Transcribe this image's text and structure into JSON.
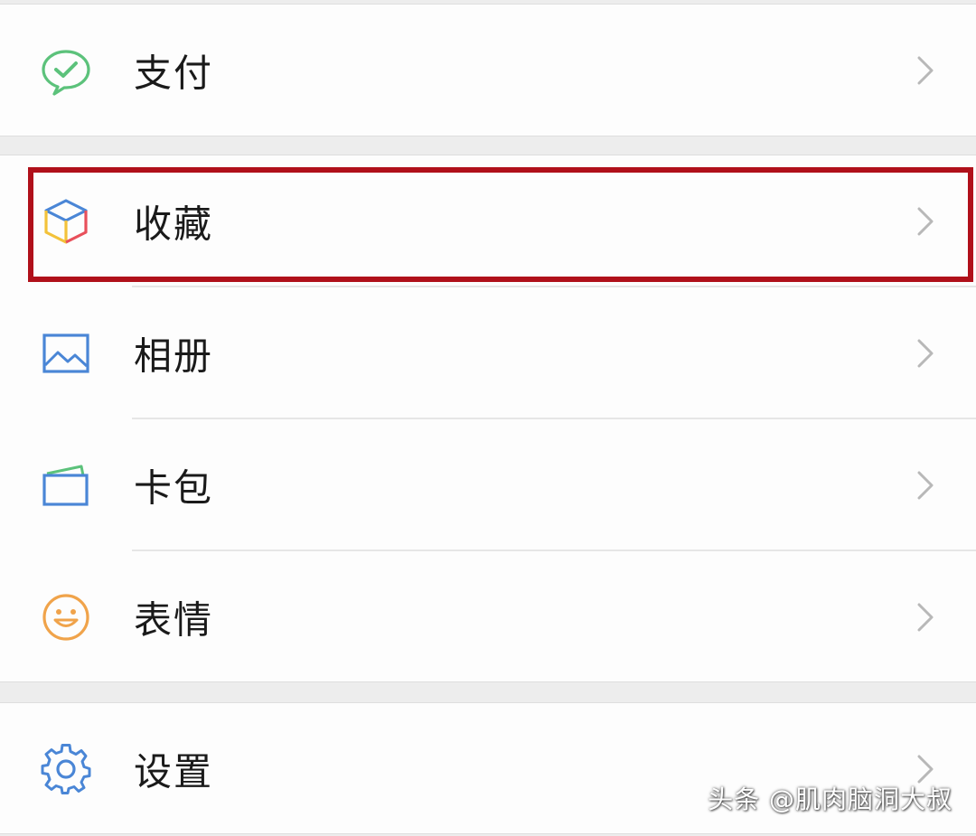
{
  "menu": {
    "pay": {
      "label": "支付",
      "icon": "wechat-pay-icon"
    },
    "favorites": {
      "label": "收藏",
      "icon": "favorites-cube-icon"
    },
    "album": {
      "label": "相册",
      "icon": "album-picture-icon"
    },
    "cards": {
      "label": "卡包",
      "icon": "card-wallet-icon"
    },
    "stickers": {
      "label": "表情",
      "icon": "smiley-face-icon"
    },
    "settings": {
      "label": "设置",
      "icon": "gear-icon"
    }
  },
  "highlight": {
    "target": "favorites",
    "color": "#b0101a"
  },
  "watermark": "头条 @肌肉脑洞大叔",
  "colors": {
    "pay_green": "#5cc27b",
    "album_blue": "#4a86d6",
    "sticker_orange": "#f0a34a",
    "chevron": "#b8b8b8"
  }
}
